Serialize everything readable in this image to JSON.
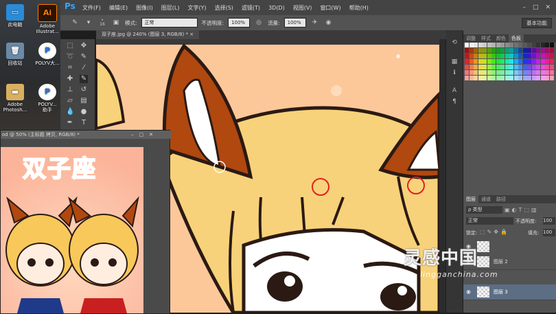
{
  "desktop": {
    "icons": [
      {
        "label": "此电脑",
        "icon": "computer-icon"
      },
      {
        "label": "Adobe Illustrat...",
        "icon": "illustrator-icon"
      },
      {
        "label": "回收站",
        "icon": "recycle-bin-icon"
      },
      {
        "label": "POLYV大...",
        "icon": "polyv-icon"
      },
      {
        "label": "Adobe Photosh...",
        "icon": "folder-icon"
      },
      {
        "label": "POLYV...\n助手",
        "icon": "polyv-icon"
      }
    ]
  },
  "app": {
    "logo": "Ps"
  },
  "menubar": {
    "items": [
      "文件(F)",
      "编辑(E)",
      "图像(I)",
      "图层(L)",
      "文字(Y)",
      "选择(S)",
      "滤镜(T)",
      "3D(D)",
      "视图(V)",
      "窗口(W)",
      "帮助(H)"
    ],
    "window_controls": [
      "–",
      "□",
      "✕"
    ]
  },
  "options_bar": {
    "brush_size": "16",
    "mode_label": "模式:",
    "mode_value": "正常",
    "opacity_label": "不透明度:",
    "opacity_value": "100%",
    "flow_label": "流量:",
    "flow_value": "100%",
    "workspace": "基本功能"
  },
  "document": {
    "tab_title": "双子座.jpg @ 240% (图层 3, RGB/8) *"
  },
  "second_document": {
    "title": "od @ 50% (主标题 拷贝, RGB/8) *",
    "heading": "双子座"
  },
  "panels": {
    "color_tabs": [
      "调整",
      "样式",
      "颜色",
      "色板"
    ],
    "active_color_tab": "色板",
    "layers_tabs": [
      "图层",
      "通道",
      "路径"
    ],
    "kind_filter": "ρ 类型",
    "blend_mode": "正常",
    "opacity_label": "不透明度:",
    "opacity_value": "100",
    "lock_label": "锁定:",
    "fill_label": "填充:",
    "fill_value": "100",
    "layers": [
      {
        "name": "图层 2"
      },
      {
        "name": "图层 3"
      }
    ]
  },
  "watermark": {
    "main": "灵感中国",
    "sub": "lingganchina.com"
  }
}
